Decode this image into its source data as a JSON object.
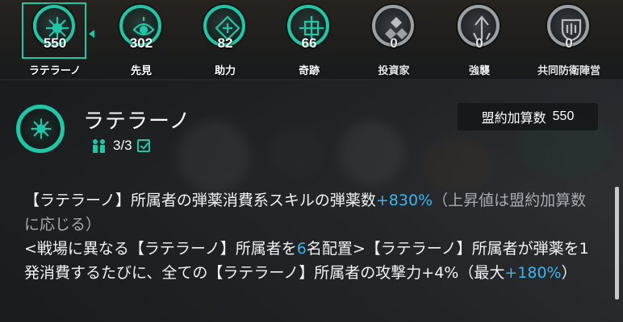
{
  "colors": {
    "accent": "#1ec7a6",
    "highlight": "#39b6ee",
    "inactive": "#9aa1a4"
  },
  "factions": [
    {
      "label": "ラテラーノ",
      "count": "550",
      "icon": "laterano-emblem-icon",
      "active": true,
      "selected": true
    },
    {
      "label": "先見",
      "count": "302",
      "icon": "foresight-emblem-icon",
      "active": true
    },
    {
      "label": "助力",
      "count": "82",
      "icon": "assist-emblem-icon",
      "active": true
    },
    {
      "label": "奇跡",
      "count": "66",
      "icon": "miracle-emblem-icon",
      "active": true
    },
    {
      "label": "投資家",
      "count": "0",
      "icon": "investor-emblem-icon",
      "active": false
    },
    {
      "label": "強襲",
      "count": "0",
      "icon": "assault-emblem-icon",
      "active": false
    },
    {
      "label": "共同防衛陣営",
      "count": "0",
      "icon": "joint-defense-emblem-icon",
      "active": false
    }
  ],
  "detail": {
    "name": "ラテラーノ",
    "members": "3/3",
    "contract_label": "盟約加算数",
    "contract_value": "550",
    "desc": {
      "p1_a": "【ラテラーノ】所属者の弾薬消費系スキルの弾薬数",
      "p1_hl": "+830%",
      "p1_b": "（上昇値は盟約加算数に応じる）",
      "p2_a": "<戦場に異なる【ラテラーノ】所属者を",
      "p2_hl": "6",
      "p2_b": "名配置>【ラテラーノ】所属者が弾薬を1発消費するたびに、全ての【ラテラーノ】所属者の攻撃力+4%（最大",
      "p2_hl2": "+180%",
      "p2_c": "）"
    }
  }
}
